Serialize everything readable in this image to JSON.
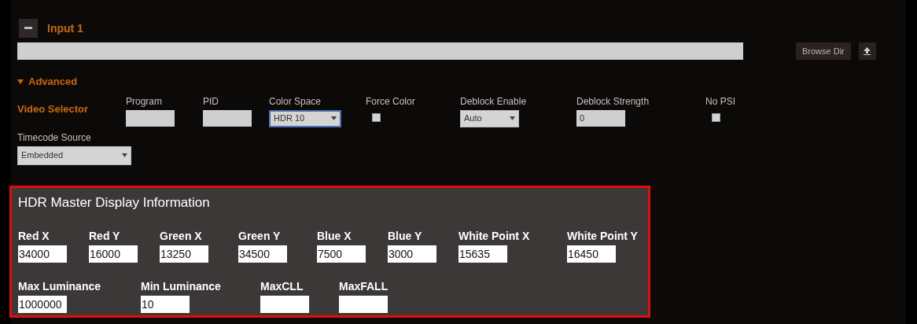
{
  "header": {
    "title": "Input 1"
  },
  "browse_button": "Browse Dir",
  "advanced": {
    "label": "Advanced",
    "expanded": true
  },
  "video_selector": {
    "label": "Video Selector",
    "fields": [
      {
        "kind": "text",
        "label": "Program"
      },
      {
        "kind": "text",
        "label": "PID"
      },
      {
        "kind": "select",
        "label": "Color Space",
        "value": "HDR 10",
        "focused": true
      },
      {
        "kind": "checkbox",
        "label": "Force Color",
        "checked": false
      },
      {
        "kind": "select",
        "label": "Deblock Enable",
        "value": "Auto",
        "focused": false
      },
      {
        "kind": "text",
        "label": "Deblock Strength",
        "value": "0"
      },
      {
        "kind": "checkbox",
        "label": "No PSI",
        "checked": false
      }
    ]
  },
  "timecode_source": {
    "label": "Timecode Source",
    "value": "Embedded"
  },
  "hdr_panel": {
    "title": "HDR Master Display Information",
    "primaries_fields": [
      {
        "label": "Red X",
        "value": "34000"
      },
      {
        "label": "Red Y",
        "value": "16000"
      },
      {
        "label": "Green X",
        "value": "13250"
      },
      {
        "label": "Green Y",
        "value": "34500"
      },
      {
        "label": "Blue X",
        "value": "7500"
      },
      {
        "label": "Blue Y",
        "value": "3000"
      },
      {
        "label": "White Point X",
        "value": "15635"
      },
      {
        "label": "White Point Y",
        "value": "16450"
      }
    ],
    "luminance_fields": [
      {
        "label": "Max Luminance",
        "value": "1000000"
      },
      {
        "label": "Min Luminance",
        "value": "10"
      },
      {
        "label": "MaxCLL"
      },
      {
        "label": "MaxFALL"
      }
    ]
  }
}
